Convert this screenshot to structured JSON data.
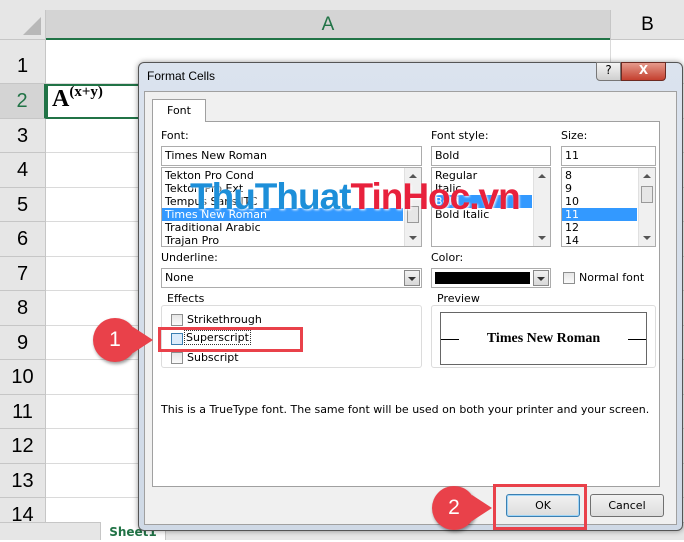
{
  "sheet": {
    "columns": [
      "A",
      "B"
    ],
    "rows": [
      "1",
      "2",
      "3",
      "4",
      "5",
      "6",
      "7",
      "8",
      "9",
      "10",
      "11",
      "12",
      "13",
      "14"
    ],
    "cell_a2": {
      "base": "A",
      "superscript": "(x+y)"
    },
    "tab": "Sheet1"
  },
  "dialog": {
    "title": "Format Cells",
    "help": "?",
    "close": "X",
    "tab": "Font",
    "font": {
      "label": "Font:",
      "value": "Times New Roman",
      "items": [
        "Tekton Pro Cond",
        "Tekton Pro Ext",
        "Tempus Sans ITC",
        "Times New Roman",
        "Traditional Arabic",
        "Trajan Pro"
      ],
      "selected": 3
    },
    "font_style": {
      "label": "Font style:",
      "value": "Bold",
      "items": [
        "Regular",
        "Italic",
        "Bold",
        "Bold Italic"
      ],
      "selected": 2
    },
    "size": {
      "label": "Size:",
      "value": "11",
      "items": [
        "8",
        "9",
        "10",
        "11",
        "12",
        "14"
      ],
      "selected": 3
    },
    "underline": {
      "label": "Underline:",
      "value": "None"
    },
    "color": {
      "label": "Color:",
      "value": "#000000"
    },
    "normal_font": "Normal font",
    "effects": {
      "title": "Effects",
      "strikethrough": "Strikethrough",
      "superscript": "Superscript",
      "subscript": "Subscript"
    },
    "preview": {
      "title": "Preview",
      "text": "Times New Roman"
    },
    "info": "This is a TrueType font.  The same font will be used on both your printer and your screen.",
    "ok": "OK",
    "cancel": "Cancel"
  },
  "callouts": [
    "1",
    "2"
  ],
  "watermark": {
    "part1": "ThuThuat",
    "part2": "TinHoc.vn"
  },
  "colors": {
    "excel_green": "#217346",
    "callout_red": "#e9414a",
    "selection": "#3399ff"
  }
}
